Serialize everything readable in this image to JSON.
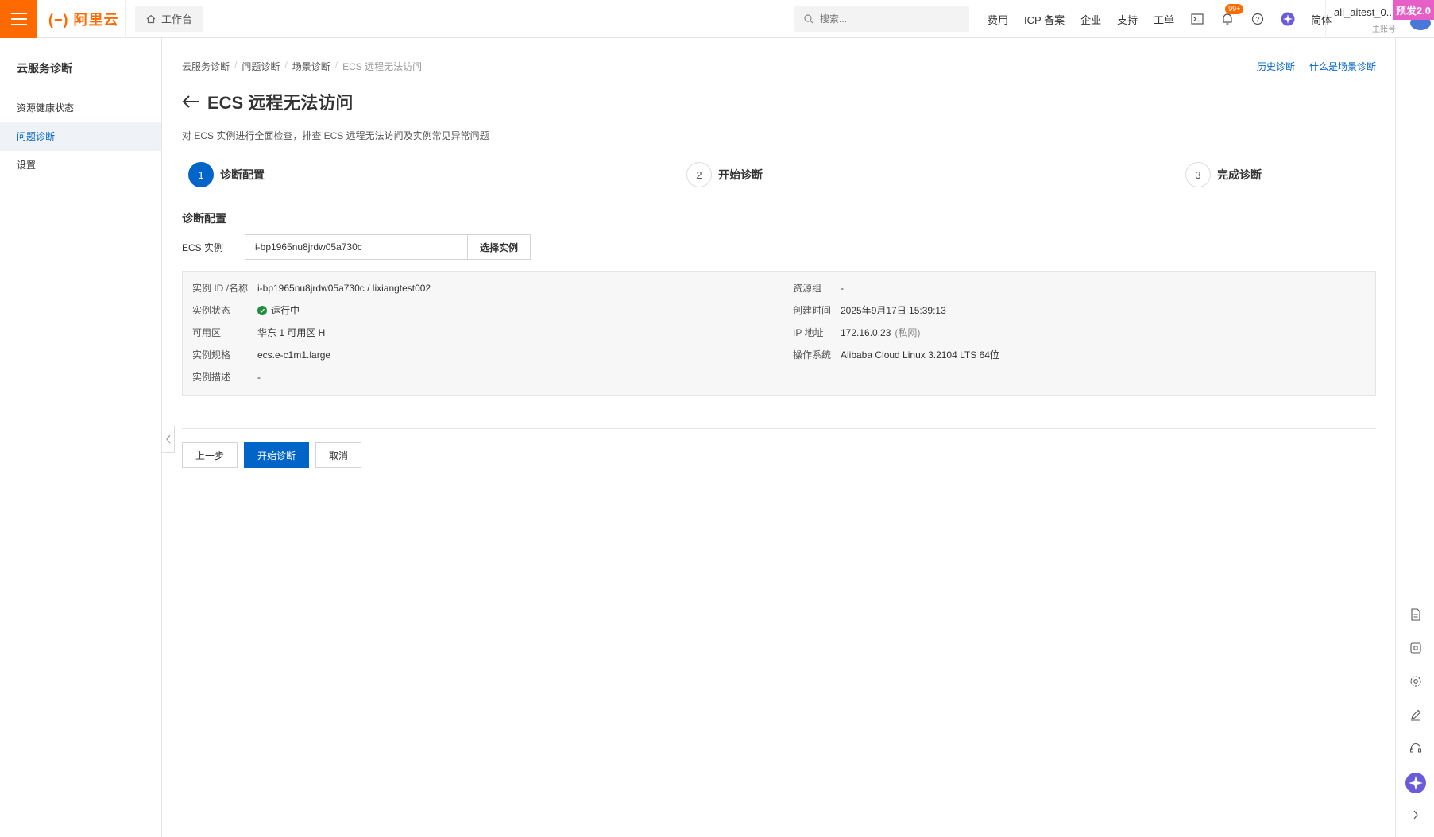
{
  "topbar": {
    "logo_text": "阿里云",
    "workbench_label": "工作台",
    "search_placeholder": "搜索...",
    "links": [
      "费用",
      "ICP 备案",
      "企业",
      "支持",
      "工单"
    ],
    "notification_badge": "99+",
    "language": "简体",
    "user_name": "ali_aitest_0...",
    "user_role": "主账号",
    "env_tag": "预发2.0",
    "accent_color": "#ff6a00"
  },
  "sidebar": {
    "title": "云服务诊断",
    "items": [
      {
        "label": "资源健康状态",
        "active": false
      },
      {
        "label": "问题诊断",
        "active": true
      },
      {
        "label": "设置",
        "active": false
      }
    ]
  },
  "breadcrumb": [
    "云服务诊断",
    "问题诊断",
    "场景诊断",
    "ECS 远程无法访问"
  ],
  "top_links": [
    "历史诊断",
    "什么是场景诊断"
  ],
  "page": {
    "title": "ECS 远程无法访问",
    "description": "对 ECS 实例进行全面检查，排查 ECS 远程无法访问及实例常见异常问题"
  },
  "steps": [
    {
      "number": "1",
      "label": "诊断配置",
      "active": true
    },
    {
      "number": "2",
      "label": "开始诊断",
      "active": false
    },
    {
      "number": "3",
      "label": "完成诊断",
      "active": false
    }
  ],
  "config": {
    "section_title": "诊断配置",
    "ecs_label": "ECS 实例",
    "ecs_value": "i-bp1965nu8jrdw05a730c",
    "select_button": "选择实例"
  },
  "instance_info": {
    "left": [
      {
        "key": "实例 ID /名称",
        "value": "i-bp1965nu8jrdw05a730c / lixiangtest002"
      },
      {
        "key": "实例状态",
        "value": "运行中"
      },
      {
        "key": "可用区",
        "value": "华东 1 可用区 H"
      },
      {
        "key": "实例规格",
        "value": "ecs.e-c1m1.large"
      },
      {
        "key": "实例描述",
        "value": "-"
      }
    ],
    "right": [
      {
        "key": "资源组",
        "value": "-"
      },
      {
        "key": "创建时间",
        "value": "2025年9月17日 15:39:13"
      },
      {
        "key": "IP 地址",
        "value": "172.16.0.23",
        "note": "(私网)"
      },
      {
        "key": "操作系统",
        "value": "Alibaba Cloud Linux 3.2104 LTS 64位"
      }
    ],
    "status_color": "#1e8e3e"
  },
  "actions": {
    "prev": "上一步",
    "start": "开始诊断",
    "cancel": "取消"
  },
  "primary_color": "#0064c8"
}
